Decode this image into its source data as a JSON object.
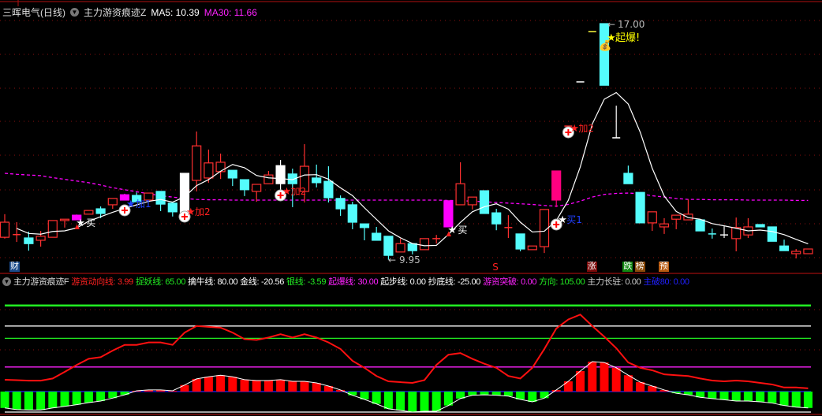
{
  "header": {
    "stock": "三晖电气(日线)",
    "indicator": "主力游资痕迹Z",
    "ma5": "MA5: 10.39",
    "ma30": "MA30: 11.66"
  },
  "sub_header": {
    "indicator": "主力游资痕迹F",
    "items": [
      {
        "text": "游资动向线: 3.99",
        "color": "#ff2020"
      },
      {
        "text": "捉妖线: 65.00",
        "color": "#22ee22"
      },
      {
        "text": "擒牛线: 80.00",
        "color": "#ffffff"
      },
      {
        "text": "金线: -20.56",
        "color": "#ffffff"
      },
      {
        "text": "银线: -3.59",
        "color": "#22ee22"
      },
      {
        "text": "起爆线: 30.00",
        "color": "#ff22ff"
      },
      {
        "text": "起步线: 0.00",
        "color": "#ffffff"
      },
      {
        "text": "抄底线: -25.00",
        "color": "#ffffff"
      },
      {
        "text": "游资突破: 0.00",
        "color": "#ff22ff"
      },
      {
        "text": "方向: 105.00",
        "color": "#22ee22"
      },
      {
        "text": "主力长驻: 0.00",
        "color": "#cccccc"
      },
      {
        "text": "主破80: 0.00",
        "color": "#2020ff"
      }
    ]
  },
  "annotations": {
    "high_label": "17.00",
    "low_label": "9.95",
    "buy": "买",
    "buy1": "买1",
    "add1": "加1",
    "add2": "加2",
    "burst": "起爆!",
    "sell": "S",
    "tags": [
      {
        "text": "财",
        "bg": "#1a4a8a"
      },
      {
        "text": "涨",
        "bg": "#7a0a0a"
      },
      {
        "text": "跌",
        "bg": "#118811"
      },
      {
        "text": "榜",
        "bg": "#8a4a0a"
      },
      {
        "text": "预",
        "bg": "#b85a10"
      }
    ]
  },
  "colors": {
    "up": "#ff3030",
    "down": "#54fcfc",
    "ma5": "#ffffff",
    "ma30": "#ff00ff",
    "grid": "#8a1010"
  },
  "chart_data": [
    {
      "type": "candlestick",
      "title": "三晖电气(日线)",
      "ylim": [
        9.95,
        17.0
      ],
      "candles_ohlc_color": [
        [
          10.62,
          11.31,
          10.58,
          11.07,
          "r"
        ],
        [
          10.69,
          11.07,
          10.48,
          10.7,
          "r"
        ],
        [
          10.6,
          10.79,
          10.22,
          10.43,
          "c"
        ],
        [
          10.53,
          10.81,
          10.34,
          10.65,
          "r"
        ],
        [
          10.62,
          11.12,
          10.62,
          11.12,
          "r"
        ],
        [
          11.12,
          11.16,
          10.91,
          11.16,
          "r"
        ],
        [
          11.28,
          11.3,
          11.14,
          11.14,
          "m"
        ],
        [
          11.31,
          11.42,
          11.31,
          11.42,
          "r"
        ],
        [
          11.47,
          11.54,
          11.19,
          11.33,
          "c"
        ],
        [
          11.59,
          11.78,
          11.47,
          11.78,
          "r"
        ],
        [
          11.89,
          11.92,
          11.73,
          11.73,
          "m"
        ],
        [
          11.87,
          11.96,
          11.68,
          11.68,
          "c"
        ],
        [
          11.73,
          11.94,
          11.73,
          11.94,
          "r"
        ],
        [
          11.99,
          11.99,
          11.4,
          11.61,
          "c"
        ],
        [
          11.64,
          11.64,
          11.24,
          11.38,
          "c"
        ],
        [
          11.35,
          12.53,
          11.35,
          12.53,
          "w"
        ],
        [
          12.32,
          13.78,
          11.99,
          13.35,
          "r"
        ],
        [
          12.39,
          13.24,
          12.25,
          12.84,
          "r"
        ],
        [
          12.58,
          13.12,
          12.36,
          12.86,
          "r"
        ],
        [
          12.62,
          12.62,
          12.15,
          12.39,
          "c"
        ],
        [
          12.34,
          12.34,
          11.85,
          12.04,
          "c"
        ],
        [
          11.99,
          12.2,
          11.68,
          12.2,
          "r"
        ],
        [
          12.22,
          12.6,
          12.22,
          12.48,
          "r"
        ],
        [
          12.22,
          12.93,
          12.01,
          12.76,
          "w"
        ],
        [
          12.51,
          12.67,
          11.52,
          12.22,
          "c"
        ],
        [
          11.99,
          13.4,
          11.66,
          12.74,
          "r"
        ],
        [
          12.39,
          12.79,
          12.11,
          12.25,
          "c"
        ],
        [
          12.29,
          12.74,
          11.66,
          11.8,
          "c"
        ],
        [
          11.78,
          11.87,
          11.26,
          11.47,
          "c"
        ],
        [
          11.59,
          11.68,
          10.86,
          11.07,
          "c"
        ],
        [
          11.02,
          11.02,
          10.53,
          10.91,
          "c"
        ],
        [
          10.74,
          10.93,
          10.53,
          10.53,
          "c"
        ],
        [
          10.65,
          10.65,
          9.95,
          10.08,
          "c"
        ],
        [
          10.18,
          10.58,
          10.18,
          10.43,
          "r"
        ],
        [
          10.43,
          10.43,
          10.11,
          10.22,
          "c"
        ],
        [
          10.25,
          10.58,
          10.25,
          10.58,
          "r"
        ],
        [
          10.57,
          10.69,
          10.43,
          10.58,
          "r"
        ],
        [
          10.93,
          11.71,
          10.93,
          11.71,
          "m"
        ],
        [
          11.59,
          12.86,
          11.59,
          12.22,
          "r"
        ],
        [
          11.59,
          11.82,
          11.45,
          11.82,
          "r"
        ],
        [
          12.01,
          12.01,
          11.33,
          11.33,
          "c"
        ],
        [
          11.35,
          11.47,
          10.83,
          11.02,
          "c"
        ],
        [
          10.9,
          11.28,
          10.6,
          10.91,
          "r"
        ],
        [
          10.72,
          10.72,
          10.2,
          10.27,
          "c"
        ],
        [
          10.25,
          10.36,
          10.25,
          10.36,
          "r"
        ],
        [
          10.34,
          11.45,
          10.15,
          11.45,
          "r"
        ],
        [
          11.73,
          12.6,
          11.52,
          12.6,
          "p"
        ],
        [
          13.94,
          13.94,
          13.94,
          13.94,
          "r"
        ],
        [
          15.26,
          15.26,
          15.26,
          15.26,
          "w"
        ],
        [
          16.76,
          16.76,
          16.76,
          16.76,
          "y"
        ],
        [
          17.0,
          17.0,
          15.16,
          15.16,
          "c"
        ],
        [
          13.59,
          14.55,
          13.59,
          13.59,
          "w"
        ],
        [
          12.53,
          12.76,
          12.22,
          12.22,
          "c"
        ],
        [
          11.96,
          11.96,
          11.05,
          11.05,
          "c"
        ],
        [
          11.05,
          11.38,
          10.81,
          11.38,
          "r"
        ],
        [
          10.93,
          11.19,
          10.72,
          11.02,
          "r"
        ],
        [
          11.16,
          11.28,
          10.86,
          11.28,
          "r"
        ],
        [
          11.14,
          11.75,
          11.14,
          11.31,
          "r"
        ],
        [
          11.14,
          11.14,
          10.81,
          10.81,
          "c"
        ],
        [
          10.72,
          10.88,
          10.58,
          10.72,
          "c"
        ],
        [
          10.69,
          10.95,
          10.6,
          10.69,
          "w"
        ],
        [
          10.58,
          11.21,
          10.2,
          10.91,
          "r"
        ],
        [
          10.69,
          11.19,
          10.6,
          10.93,
          "r"
        ],
        [
          11.0,
          11.0,
          10.93,
          10.93,
          "c"
        ],
        [
          10.93,
          10.93,
          10.5,
          10.5,
          "c"
        ],
        [
          10.36,
          10.55,
          10.22,
          10.22,
          "c"
        ],
        [
          10.13,
          10.27,
          9.99,
          10.2,
          "r"
        ],
        [
          10.13,
          10.27,
          10.13,
          10.27,
          "r"
        ]
      ],
      "ma30": [
        12.53,
        12.5,
        12.48,
        12.46,
        12.4,
        12.35,
        12.3,
        12.25,
        12.18,
        12.1,
        12.04,
        11.98,
        11.92,
        11.86,
        11.82,
        11.78,
        11.75,
        11.74,
        11.74,
        11.73,
        11.73,
        11.73,
        11.73,
        11.73,
        11.73,
        11.73,
        11.73,
        11.73,
        11.73,
        11.73,
        11.73,
        11.73,
        11.73,
        11.73,
        11.73,
        11.73,
        11.73,
        11.72,
        11.71,
        11.7,
        11.68,
        11.66,
        11.64,
        11.62,
        11.6,
        11.57,
        11.55,
        11.6,
        11.7,
        11.82,
        11.9,
        11.93,
        11.94,
        11.92,
        11.86,
        11.82,
        11.78,
        11.75,
        11.75,
        11.74,
        11.74,
        11.74,
        11.73,
        11.73,
        11.73,
        11.73,
        11.72,
        11.72
      ],
      "markers": {
        "buy": [
          6,
          37
        ],
        "buy1": [
          46
        ],
        "add1": [
          10
        ],
        "add2": [
          15,
          23,
          47
        ],
        "burst": [
          50
        ],
        "up_arrow": [
          6,
          37
        ],
        "sell": [
          41
        ],
        "tag_index": [
          0,
          49,
          52,
          53,
          55
        ]
      }
    },
    {
      "type": "line+bar",
      "title": "主力游资痕迹F",
      "ylim": [
        -25,
        105
      ],
      "reference_lines": [
        {
          "name": "方向",
          "value": 105,
          "color": "#22ee22"
        },
        {
          "name": "擒牛线",
          "value": 80,
          "color": "#ffffff"
        },
        {
          "name": "捉妖线",
          "value": 65,
          "color": "#22ee22"
        },
        {
          "name": "起爆线",
          "value": 30,
          "color": "#ff22ff"
        },
        {
          "name": "起步线",
          "value": 0,
          "color": "#2020ff"
        },
        {
          "name": "抄底线",
          "value": -25,
          "color": "#ffffff"
        }
      ],
      "line": {
        "name": "游资动向线",
        "values": [
          14.4,
          14,
          13.4,
          13.4,
          16,
          24,
          32.5,
          40,
          42,
          50,
          57,
          57,
          60,
          60,
          57,
          72,
          80,
          79,
          78,
          72,
          64,
          63,
          66,
          70,
          66,
          70,
          66,
          60,
          52,
          37.5,
          29,
          19,
          12.5,
          11.5,
          10.6,
          14,
          32.5,
          45,
          47,
          40,
          34,
          29,
          19,
          16,
          29,
          52,
          77,
          88,
          94,
          80,
          67,
          53,
          35.5,
          29,
          26,
          21,
          20,
          19,
          16,
          13.5,
          12.5,
          13.5,
          12.5,
          10.6,
          8.7,
          5,
          5,
          4
        ]
      },
      "bars": {
        "values": [
          -20,
          -22,
          -22.5,
          -22.5,
          -20,
          -18,
          -16,
          -13.5,
          -11.5,
          -8,
          -4,
          1,
          2,
          2,
          1,
          8,
          15.5,
          18,
          20,
          18,
          14.5,
          13.5,
          13.5,
          14.5,
          12.5,
          12.5,
          10.6,
          6.7,
          2,
          -4.5,
          -9.5,
          -15,
          -21,
          -23,
          -25,
          -24,
          -24,
          -17,
          -8.5,
          -4.5,
          -4,
          -4.5,
          -5.5,
          -9.5,
          -12.5,
          -8,
          2,
          12.5,
          25,
          36.5,
          35.5,
          29,
          20,
          11.5,
          6.7,
          2,
          -2,
          -4,
          -7,
          -8.5,
          -10,
          -11.5,
          -11.5,
          -12.5,
          -14,
          -17,
          -19,
          -20
        ]
      }
    }
  ]
}
